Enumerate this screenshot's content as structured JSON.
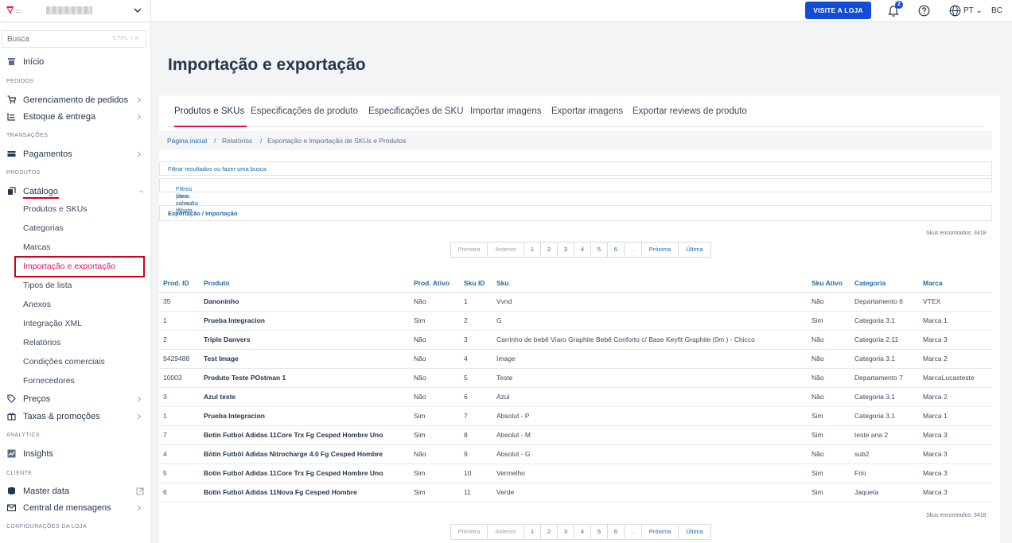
{
  "topbar": {
    "visit_store": "VISITE A LOJA",
    "notifications_count": "2",
    "language": "PT",
    "user_initials": "BC"
  },
  "sidebar": {
    "search_placeholder": "Busca",
    "search_shortcut": "CTRL + K",
    "home": "Início",
    "sections": {
      "orders": "PEDIDOS",
      "transactions": "TRANSAÇÕES",
      "products": "PRODUTOS",
      "analytics": "ANALYTICS",
      "client": "CLIENTE",
      "store_settings": "CONFIGURAÇÕES DA LOJA"
    },
    "order_management": "Gerenciamento de pedidos",
    "stock_delivery": "Estoque & entrega",
    "payments": "Pagamentos",
    "catalog": "Catálogo",
    "catalog_items": [
      "Produtos e SKUs",
      "Categorias",
      "Marcas",
      "Importação e exportação",
      "Tipos de lista",
      "Anexos",
      "Integração XML",
      "Relatórios",
      "Condições comerciais",
      "Fornecedores"
    ],
    "prices": "Preços",
    "taxes_promotions": "Taxas & promoções",
    "insights": "Insights",
    "master_data": "Master data",
    "message_center": "Central de mensagens"
  },
  "page": {
    "title": "Importação e exportação",
    "tabs": [
      "Produtos e SKUs",
      "Especificações de produto",
      "Especificações de SKU",
      "Importar imagens",
      "Exportar imagens",
      "Exportar reviews de produto"
    ],
    "breadcrumb": [
      "Página inicial",
      "/",
      "Relatórios",
      "/",
      "Exportação e Importação de SKUs e Produtos"
    ],
    "filter_search": "Filtrar resultados ou fazer uma busca",
    "quick_filters": "Filtros para consulta rápida",
    "quick_filters_suffix": " - filtros salvos [0]",
    "export_import": "Exportação / Importação",
    "skus_found": "Skus encontrados: 3418",
    "pager": [
      "Primeira",
      "Anterior",
      "1",
      "2",
      "3",
      "4",
      "5",
      "6",
      "...",
      "Próxima",
      "Última"
    ]
  },
  "table": {
    "headers": [
      "Prod. ID",
      "Produto",
      "Prod. Ativo",
      "Sku ID",
      "Sku",
      "Sku Ativo",
      "Categoria",
      "Marca"
    ],
    "rows": [
      [
        "35",
        "Danoninho",
        "Não",
        "1",
        "Vvnd",
        "Não",
        "Departamento 6",
        "VTEX"
      ],
      [
        "1",
        "Prueba Integracion",
        "Sim",
        "2",
        "G",
        "Sim",
        "Categoria 3.1",
        "Marca 1"
      ],
      [
        "2",
        "Triple Danvers",
        "Não",
        "3",
        "Carrinho de bebê Viaro Graphite Bebê Conforto c/ Base Keyfit Graphite (0m ) - Chicco",
        "Não",
        "Categoria 2.11",
        "Marca 3"
      ],
      [
        "9429488",
        "Test Image",
        "Não",
        "4",
        "Image",
        "Não",
        "Categoria 3.1",
        "Marca 2"
      ],
      [
        "10003",
        "Produto Teste POstman 1",
        "Não",
        "5",
        "Teste",
        "Não",
        "Departamento 7",
        "MarcaLucasteste"
      ],
      [
        "3",
        "Azul teste",
        "Não",
        "6",
        "Azul",
        "Não",
        "Categoria 3.1",
        "Marca 2"
      ],
      [
        "1",
        "Prueba Integracion",
        "Sim",
        "7",
        "Absolut - P",
        "Sim",
        "Categoria 3.1",
        "Marca 1"
      ],
      [
        "7",
        "Botin Futbol Adidas 11Core Trx Fg Cesped Hombre Uno",
        "Sim",
        "8",
        "Absolut - M",
        "Sim",
        "teste ana 2",
        "Marca 3"
      ],
      [
        "4",
        "Bótin Futbôl Adidas Nitrocharge 4.0 Fg Cesped Hombre",
        "Não",
        "9",
        "Absolut - G",
        "Não",
        "sub2",
        "Marca 3"
      ],
      [
        "5",
        "Botin Futbol Adidas 11Core Trx Fg Cesped Hombre Uno",
        "Sim",
        "10",
        "Vermelho",
        "Sim",
        "Frio",
        "Marca 3"
      ],
      [
        "6",
        "Botin Futbol Adidas 11Nova Fg Cesped Hombre",
        "Sim",
        "11",
        "Verde",
        "Sim",
        "Jaqueta",
        "Marca 3"
      ]
    ]
  },
  "colors": {
    "accent_pink": "#e3125b",
    "primary_blue": "#134cd8",
    "link_blue": "#2169a8",
    "highlight_red": "#d0021b"
  }
}
